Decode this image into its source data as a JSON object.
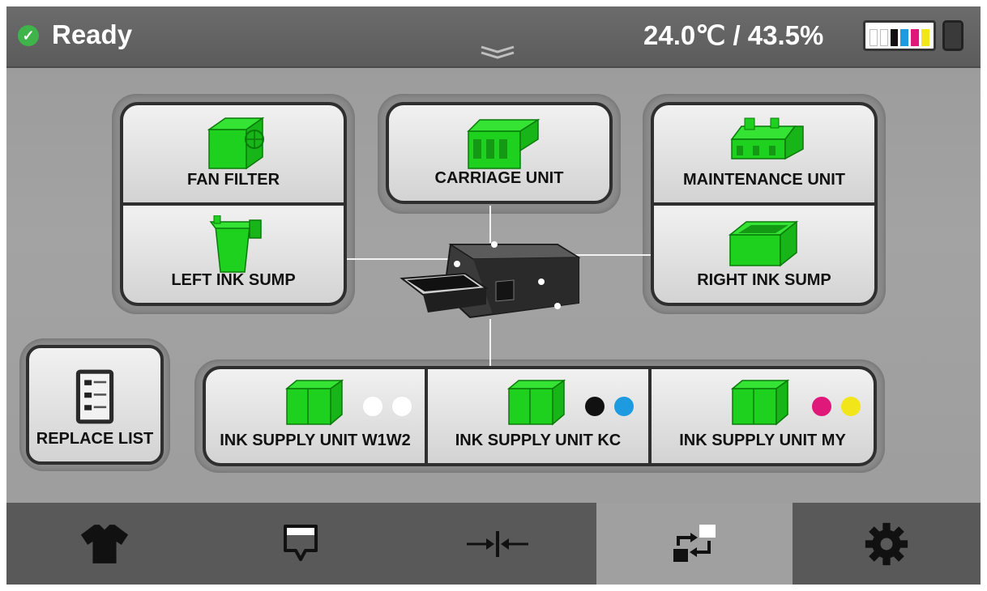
{
  "status": {
    "label": "Ready",
    "icon": "check-circle-icon",
    "color": "#3fb44a"
  },
  "environment": {
    "readout": "24.0℃ / 43.5%"
  },
  "ink_levels": [
    {
      "name": "white-1",
      "color": "#ffffff",
      "level": 0.8
    },
    {
      "name": "white-2",
      "color": "#ffffff",
      "level": 0.8
    },
    {
      "name": "black",
      "color": "#111111",
      "level": 0.8
    },
    {
      "name": "cyan",
      "color": "#1e9be0",
      "level": 0.8
    },
    {
      "name": "magenta",
      "color": "#e0187a",
      "level": 0.8
    },
    {
      "name": "yellow",
      "color": "#f2e51a",
      "level": 0.8
    }
  ],
  "parts": {
    "fan_filter": "FAN FILTER",
    "carriage_unit": "CARRIAGE UNIT",
    "maintenance_unit": "MAINTENANCE UNIT",
    "left_ink_sump": "LEFT INK SUMP",
    "right_ink_sump": "RIGHT INK SUMP",
    "ink_supply_w1w2": "INK SUPPLY UNIT W1W2",
    "ink_supply_kc": "INK SUPPLY UNIT KC",
    "ink_supply_my": "INK SUPPLY UNIT MY"
  },
  "replace_list": {
    "label": "REPLACE LIST"
  },
  "nav": [
    {
      "id": "print",
      "icon": "tshirt-icon",
      "active": false
    },
    {
      "id": "platen",
      "icon": "platen-icon",
      "active": false
    },
    {
      "id": "adjust",
      "icon": "align-arrows-icon",
      "active": false
    },
    {
      "id": "maintenance",
      "icon": "replace-parts-icon",
      "active": true
    },
    {
      "id": "settings",
      "icon": "gear-icon",
      "active": false
    }
  ],
  "colors": {
    "part_green": "#1fd11f",
    "accent_active_tab": "#a0a0a0"
  }
}
